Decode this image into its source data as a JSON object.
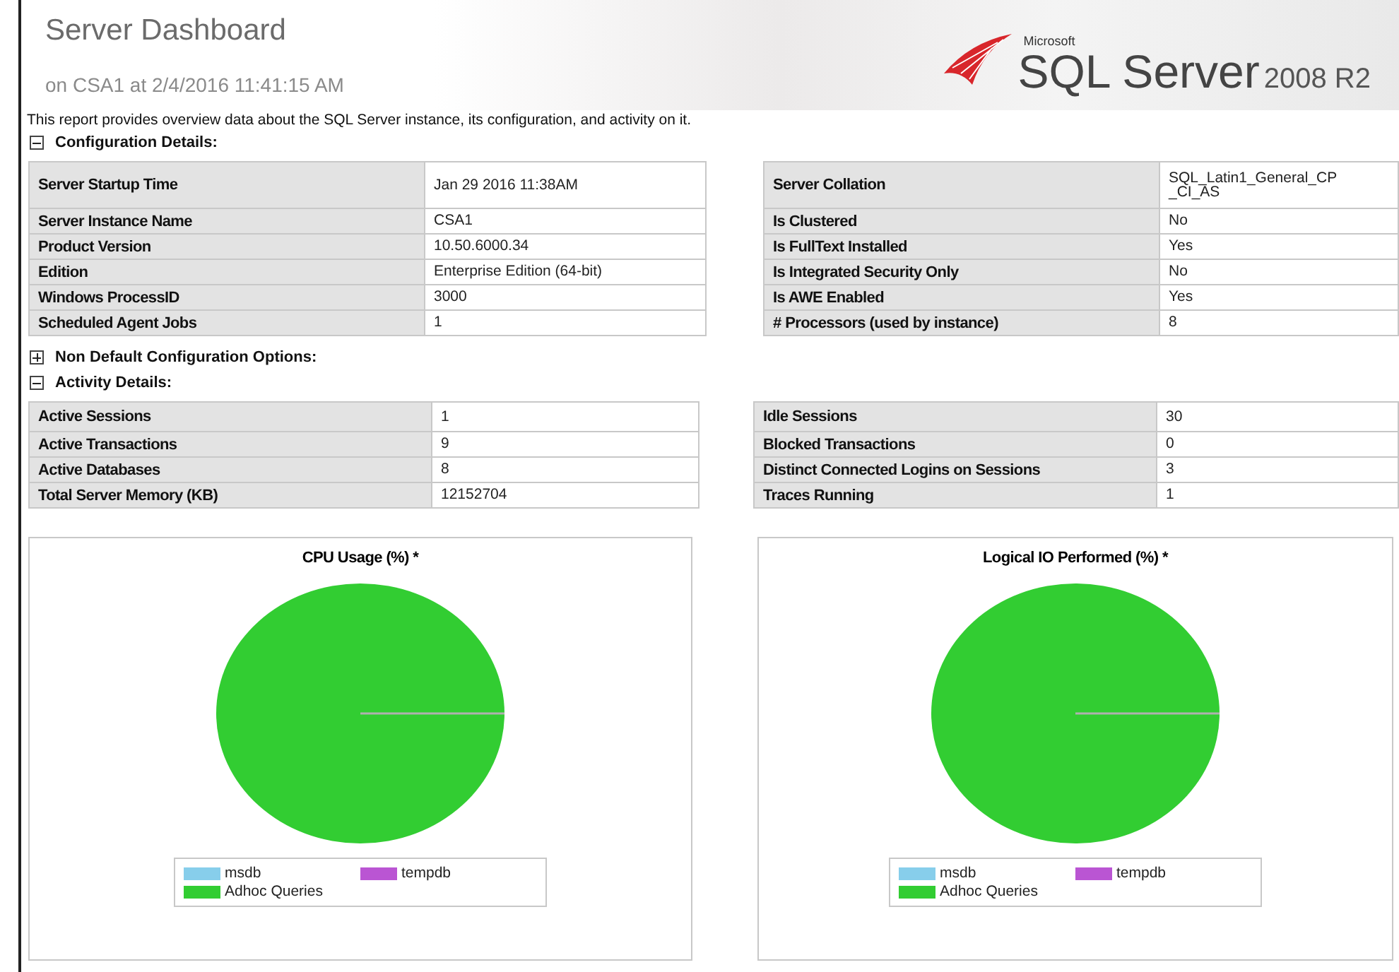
{
  "header": {
    "title": "Server Dashboard",
    "subtitle": "on CSA1 at 2/4/2016 11:41:15 AM",
    "logo": {
      "brand": "Microsoft",
      "product": "SQL Server",
      "version": "2008 R2"
    }
  },
  "description": "This report provides overview data about the SQL Server instance, its configuration, and activity on it.",
  "sections": [
    {
      "title": "Configuration Details:",
      "expanded": true,
      "tables": [
        [
          {
            "label": "Server Startup Time",
            "value": "Jan 29 2016 11:38AM"
          },
          {
            "label": "Server Instance Name",
            "value": "CSA1"
          },
          {
            "label": "Product Version",
            "value": "10.50.6000.34"
          },
          {
            "label": "Edition",
            "value": "Enterprise Edition (64-bit)"
          },
          {
            "label": "Windows ProcessID",
            "value": "3000"
          },
          {
            "label": "Scheduled Agent Jobs",
            "value": "1"
          }
        ],
        [
          {
            "label": "Server Collation",
            "value": "SQL_Latin1_General_CP\n_CI_AS"
          },
          {
            "label": "Is Clustered",
            "value": "No"
          },
          {
            "label": "Is FullText Installed",
            "value": "Yes"
          },
          {
            "label": "Is Integrated Security Only",
            "value": "No"
          },
          {
            "label": "Is AWE Enabled",
            "value": "Yes"
          },
          {
            "label": "# Processors (used by instance)",
            "value": "8"
          }
        ]
      ]
    },
    {
      "title": "Non Default Configuration Options:",
      "expanded": false
    },
    {
      "title": "Activity Details:",
      "expanded": true,
      "tables": [
        [
          {
            "label": "Active Sessions",
            "value": "1"
          },
          {
            "label": "Active Transactions",
            "value": "9"
          },
          {
            "label": "Active Databases",
            "value": "8"
          },
          {
            "label": "Total Server Memory (KB)",
            "value": "12152704"
          }
        ],
        [
          {
            "label": "Idle Sessions",
            "value": "30"
          },
          {
            "label": "Blocked Transactions",
            "value": "0"
          },
          {
            "label": "Distinct Connected Logins on Sessions",
            "value": "3"
          },
          {
            "label": "Traces Running",
            "value": "1"
          }
        ]
      ]
    }
  ],
  "charts": [
    {
      "title": "CPU Usage (%) *",
      "legend": [
        {
          "name": "msdb",
          "color": "#87ceeb"
        },
        {
          "name": "tempdb",
          "color": "#ba55d3"
        },
        {
          "name": "Adhoc Queries",
          "color": "#32cd32"
        }
      ]
    },
    {
      "title": "Logical IO Performed (%) *",
      "legend": [
        {
          "name": "msdb",
          "color": "#87ceeb"
        },
        {
          "name": "tempdb",
          "color": "#ba55d3"
        },
        {
          "name": "Adhoc Queries",
          "color": "#32cd32"
        }
      ]
    }
  ]
}
